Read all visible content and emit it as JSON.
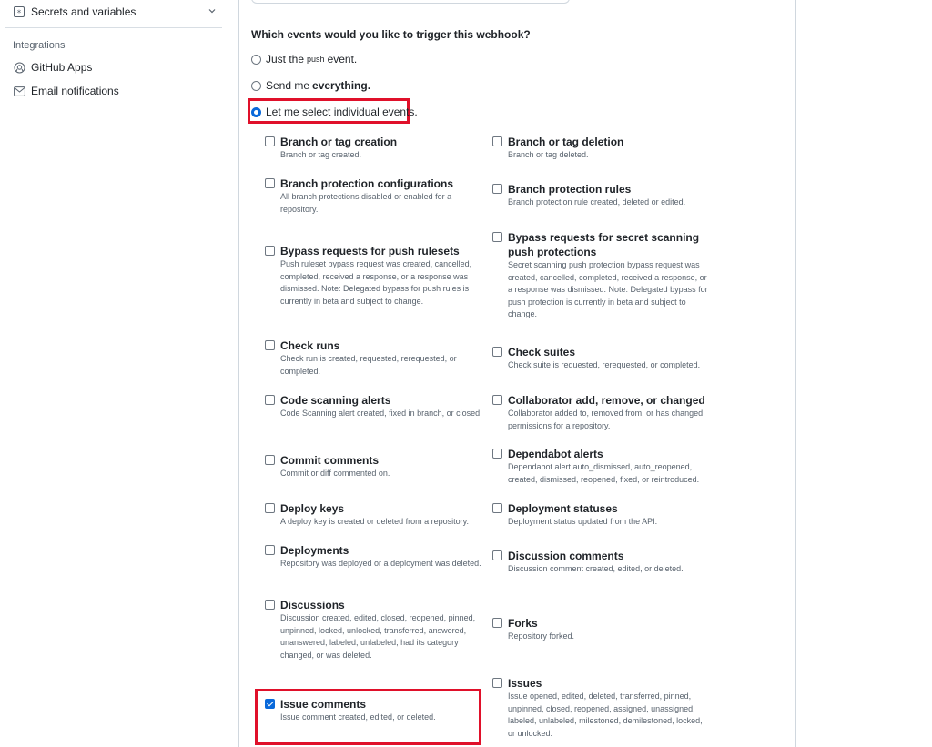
{
  "sidebar": {
    "secrets_label": "Secrets and variables",
    "integrations_heading": "Integrations",
    "github_apps_label": "GitHub Apps",
    "email_notifications_label": "Email notifications"
  },
  "webhook": {
    "question": "Which events would you like to trigger this webhook?",
    "options": {
      "just_push_prefix": "Just the",
      "just_push_code": "push",
      "just_push_suffix": "event.",
      "everything_prefix": "Send me",
      "everything_bold": "everything.",
      "select_individual": "Let me select individual events."
    },
    "events": [
      {
        "title": "Branch or tag creation",
        "desc": "Branch or tag created.",
        "checked": false
      },
      {
        "title": "Branch or tag deletion",
        "desc": "Branch or tag deleted.",
        "checked": false
      },
      {
        "title": "Branch protection configurations",
        "desc": "All branch protections disabled or enabled for a repository.",
        "checked": false
      },
      {
        "title": "Branch protection rules",
        "desc": "Branch protection rule created, deleted or edited.",
        "checked": false
      },
      {
        "title": "Bypass requests for push rulesets",
        "desc": "Push ruleset bypass request was created, cancelled, completed, received a response, or a response was dismissed. Note: Delegated bypass for push rules is currently in beta and subject to change.",
        "checked": false
      },
      {
        "title": "Bypass requests for secret scanning push protections",
        "desc": "Secret scanning push protection bypass request was created, cancelled, completed, received a response, or a response was dismissed. Note: Delegated bypass for push protection is currently in beta and subject to change.",
        "checked": false
      },
      {
        "title": "Check runs",
        "desc": "Check run is created, requested, rerequested, or completed.",
        "checked": false
      },
      {
        "title": "Check suites",
        "desc": "Check suite is requested, rerequested, or completed.",
        "checked": false
      },
      {
        "title": "Code scanning alerts",
        "desc": "Code Scanning alert created, fixed in branch, or closed",
        "checked": false
      },
      {
        "title": "Collaborator add, remove, or changed",
        "desc": "Collaborator added to, removed from, or has changed permissions for a repository.",
        "checked": false
      },
      {
        "title": "Commit comments",
        "desc": "Commit or diff commented on.",
        "checked": false
      },
      {
        "title": "Dependabot alerts",
        "desc": "Dependabot alert auto_dismissed, auto_reopened, created, dismissed, reopened, fixed, or reintroduced.",
        "checked": false
      },
      {
        "title": "Deploy keys",
        "desc": "A deploy key is created or deleted from a repository.",
        "checked": false
      },
      {
        "title": "Deployment statuses",
        "desc": "Deployment status updated from the API.",
        "checked": false
      },
      {
        "title": "Deployments",
        "desc": "Repository was deployed or a deployment was deleted.",
        "checked": false
      },
      {
        "title": "Discussion comments",
        "desc": "Discussion comment created, edited, or deleted.",
        "checked": false
      },
      {
        "title": "Discussions",
        "desc": "Discussion created, edited, closed, reopened, pinned, unpinned, locked, unlocked, transferred, answered, unanswered, labeled, unlabeled, had its category changed, or was deleted.",
        "checked": false
      },
      {
        "title": "Forks",
        "desc": "Repository forked.",
        "checked": false
      },
      {
        "title": "Issue comments",
        "desc": "Issue comment created, edited, or deleted.",
        "checked": true
      },
      {
        "title": "Issues",
        "desc": "Issue opened, edited, deleted, transferred, pinned, unpinned, closed, reopened, assigned, unassigned, labeled, unlabeled, milestoned, demilestoned, locked, or unlocked.",
        "checked": false
      }
    ]
  },
  "colors": {
    "accent": "#0969da",
    "highlight": "#e0102a"
  }
}
